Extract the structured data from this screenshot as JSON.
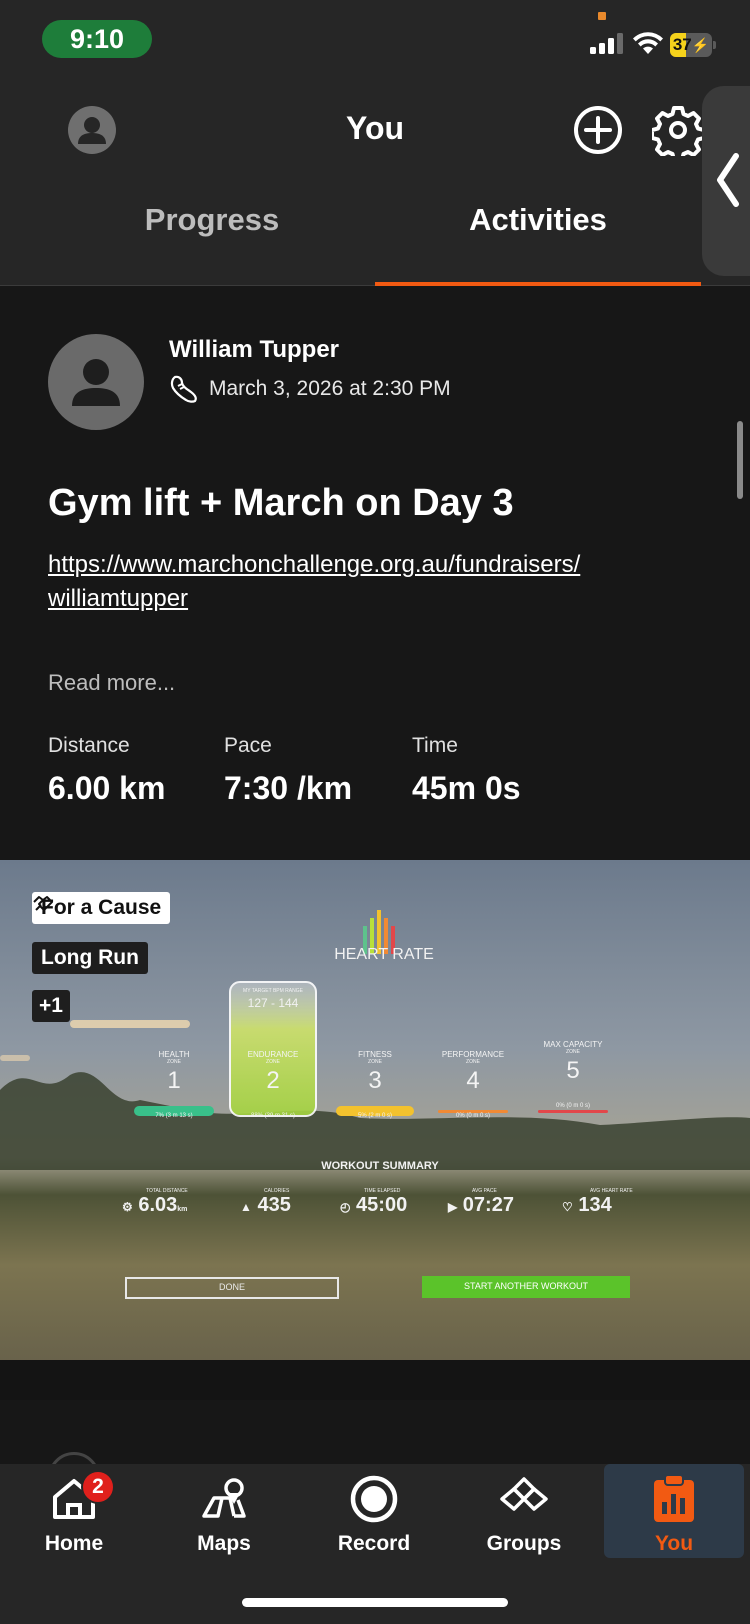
{
  "status_bar": {
    "time": "9:10",
    "battery": "37",
    "battery_level": 0.37
  },
  "header": {
    "title": "You"
  },
  "tabs": [
    {
      "label": "Progress",
      "selected": false
    },
    {
      "label": "Activities",
      "selected": true
    }
  ],
  "activity": {
    "athlete_name": "William Tupper",
    "sport_icon": "shoe-icon",
    "datetime": "March 3, 2026 at 2:30 PM",
    "title": "Gym lift + March on Day 3",
    "link_line1": "https://www.marchonchallenge.org.au/fundraisers/",
    "link_line2": "williamtupper",
    "read_more": "Read more...",
    "stats": [
      {
        "label": "Distance",
        "value": "6.00 km"
      },
      {
        "label": "Pace",
        "value": "7:30 /km"
      },
      {
        "label": "Time",
        "value": "45m 0s"
      }
    ],
    "tags": {
      "cause": "For a Cause",
      "run_type": "Long Run",
      "more": "+1"
    }
  },
  "photo": {
    "heart_rate_title": "HEART RATE",
    "target_zone_label": "MY TARGET BPM RANGE",
    "target_range": "127 - 144",
    "zones": [
      {
        "name": "HEALTH",
        "sub": "ZONE",
        "number": "1",
        "time": "7% (3 m 13 s)",
        "color": "#39c08a"
      },
      {
        "name": "ENDURANCE",
        "sub": "ZONE",
        "number": "2",
        "time": "88% (39 m 31 s)",
        "color": "#b8e03a"
      },
      {
        "name": "FITNESS",
        "sub": "ZONE",
        "number": "3",
        "time": "5% (2 m 0 s)",
        "color": "#f3c22e"
      },
      {
        "name": "PERFORMANCE",
        "sub": "ZONE",
        "number": "4",
        "time": "0% (0 m 0 s)",
        "color": "#f08a35"
      },
      {
        "name": "MAX CAPACITY",
        "sub": "ZONE",
        "number": "5",
        "time": "0% (0 m 0 s)",
        "color": "#e2474a"
      }
    ],
    "summary_title": "WORKOUT SUMMARY",
    "summary": [
      {
        "label": "TOTAL DISTANCE",
        "value": "6.03",
        "unit": "km"
      },
      {
        "label": "CALORIES",
        "value": "435",
        "unit": ""
      },
      {
        "label": "TIME ELAPSED",
        "value": "45:00",
        "unit": ""
      },
      {
        "label": "AVG PACE",
        "value": "07:27",
        "unit": ""
      },
      {
        "label": "AVG HEART RATE",
        "value": "134",
        "unit": ""
      }
    ],
    "done_label": "DONE",
    "start_label": "START ANOTHER WORKOUT"
  },
  "bottom_nav": [
    {
      "label": "Home",
      "icon": "home-icon",
      "badge": "2",
      "selected": false
    },
    {
      "label": "Maps",
      "icon": "maps-icon",
      "selected": false
    },
    {
      "label": "Record",
      "icon": "record-icon",
      "selected": false
    },
    {
      "label": "Groups",
      "icon": "groups-icon",
      "selected": false
    },
    {
      "label": "You",
      "icon": "you-icon",
      "selected": true
    }
  ],
  "colors": {
    "accent": "#f25a12",
    "background": "#171717",
    "header": "#262626",
    "badge": "#e0201c"
  }
}
